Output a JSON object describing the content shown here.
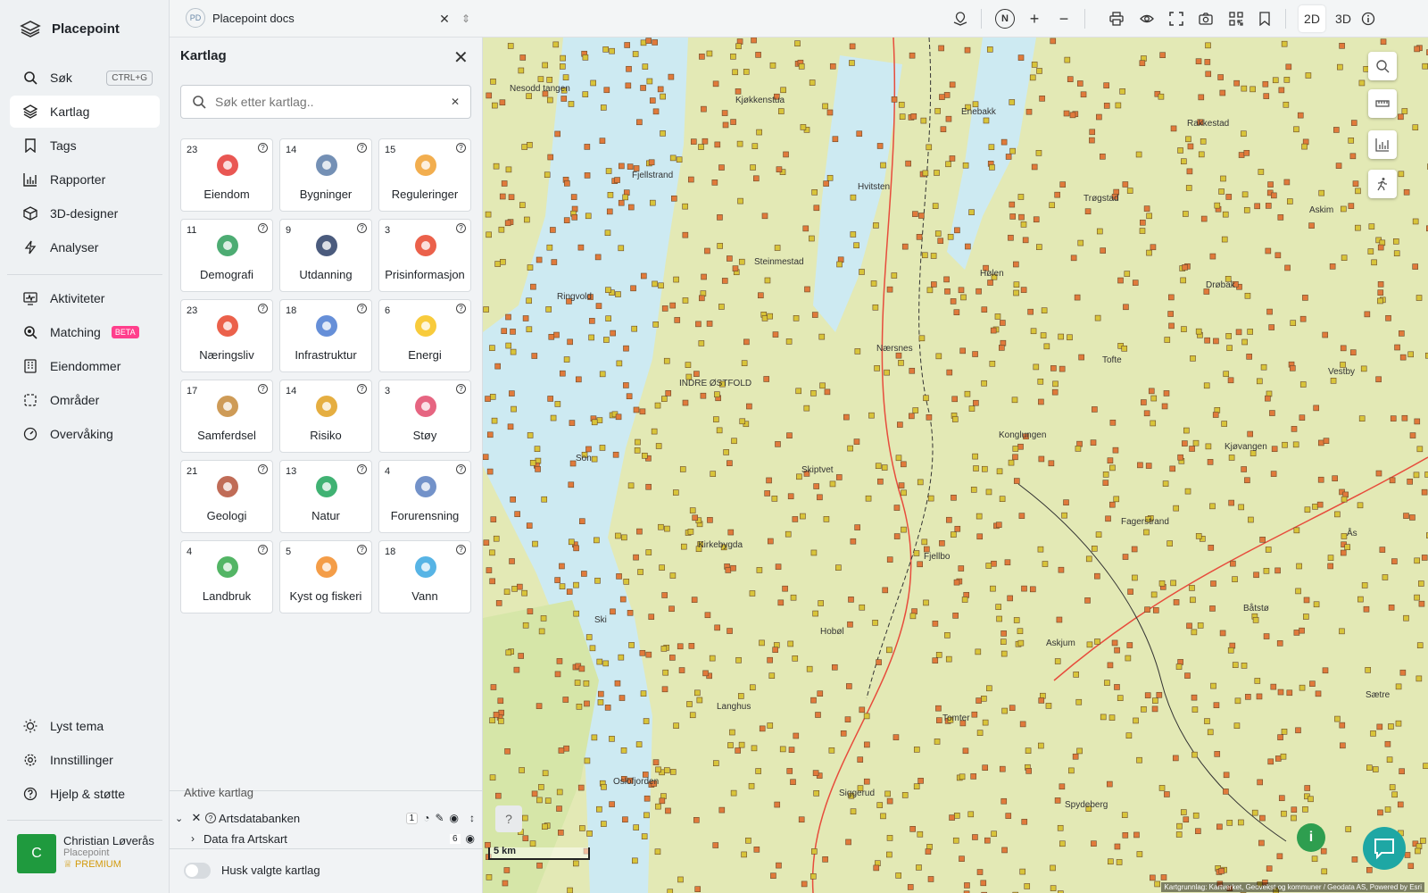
{
  "app": {
    "name": "Placepoint"
  },
  "sidebar": {
    "items": [
      {
        "label": "Søk",
        "shortcut": "CTRL+G",
        "icon": "search-icon"
      },
      {
        "label": "Kartlag",
        "icon": "layers-icon"
      },
      {
        "label": "Tags",
        "icon": "bookmark-icon"
      },
      {
        "label": "Rapporter",
        "icon": "bar-chart-icon"
      },
      {
        "label": "3D-designer",
        "icon": "cube-icon"
      },
      {
        "label": "Analyser",
        "icon": "lightning-icon"
      },
      {
        "label": "Aktiviteter",
        "icon": "activity-icon"
      },
      {
        "label": "Matching",
        "badge": "BETA",
        "icon": "search-zoom-icon"
      },
      {
        "label": "Eiendommer",
        "icon": "building-icon"
      },
      {
        "label": "Områder",
        "icon": "dashed-square-icon"
      },
      {
        "label": "Overvåking",
        "icon": "gauge-icon"
      }
    ],
    "bottom": [
      {
        "label": "Lyst tema",
        "icon": "sun-icon"
      },
      {
        "label": "Innstillinger",
        "icon": "gear-icon"
      },
      {
        "label": "Hjelp & støtte",
        "icon": "help-icon"
      }
    ],
    "user": {
      "initial": "C",
      "name": "Christian Løverås",
      "org": "Placepoint",
      "plan": "PREMIUM"
    }
  },
  "topbar": {
    "doc_badge": "PD",
    "doc_title": "Placepoint docs",
    "compass": "N",
    "mode_2d": "2D",
    "mode_3d": "3D"
  },
  "panel": {
    "title": "Kartlag",
    "search_placeholder": "Søk etter kartlag..",
    "categories": [
      {
        "count": "23",
        "label": "Eiendom",
        "icon": "map-pin-icon",
        "color": "#e53935"
      },
      {
        "count": "14",
        "label": "Bygninger",
        "icon": "office-building-icon",
        "color": "#5c7da8"
      },
      {
        "count": "15",
        "label": "Reguleringer",
        "icon": "signpost-icon",
        "color": "#f0a030"
      },
      {
        "count": "11",
        "label": "Demografi",
        "icon": "population-icon",
        "color": "#2e9e5b"
      },
      {
        "count": "9",
        "label": "Utdanning",
        "icon": "graduation-cap-icon",
        "color": "#2c3e66"
      },
      {
        "count": "3",
        "label": "Prisinformasjon",
        "icon": "shopping-bag-icon",
        "color": "#e8452c"
      },
      {
        "count": "23",
        "label": "Næringsliv",
        "icon": "shopping-bags-icon",
        "color": "#e8452c"
      },
      {
        "count": "18",
        "label": "Infrastruktur",
        "icon": "infrastructure-icon",
        "color": "#4b7bd1"
      },
      {
        "count": "6",
        "label": "Energi",
        "icon": "lightning-bolt-icon",
        "color": "#f7c21a"
      },
      {
        "count": "17",
        "label": "Samferdsel",
        "icon": "train-icon",
        "color": "#c58a3a"
      },
      {
        "count": "14",
        "label": "Risiko",
        "icon": "warning-icon",
        "color": "#e0a020"
      },
      {
        "count": "3",
        "label": "Støy",
        "icon": "noise-gauge-icon",
        "color": "#e24a6b"
      },
      {
        "count": "21",
        "label": "Geologi",
        "icon": "terrain-icon",
        "color": "#b5523a"
      },
      {
        "count": "13",
        "label": "Natur",
        "icon": "leaf-icon",
        "color": "#1ea45a"
      },
      {
        "count": "4",
        "label": "Forurensning",
        "icon": "factory-icon",
        "color": "#5a7fbf"
      },
      {
        "count": "4",
        "label": "Landbruk",
        "icon": "sprout-icon",
        "color": "#35a84a"
      },
      {
        "count": "5",
        "label": "Kyst og fiskeri",
        "icon": "fish-icon",
        "color": "#f28c28"
      },
      {
        "count": "18",
        "label": "Vann",
        "icon": "water-drop-icon",
        "color": "#3aa7e0"
      }
    ],
    "active_title": "Aktive kartlag",
    "active_layers": [
      {
        "label": "Artsdatabanken",
        "count": "1"
      },
      {
        "label": "Data fra Artskart",
        "count": "6"
      }
    ],
    "remember_label": "Husk valgte kartlag"
  },
  "map": {
    "scale": "5 km",
    "attribution": "Kartgrunnlag: Kartverket, Geovekst og kommuner / Geodata AS, Powered by Esri",
    "place_labels": [
      "Nesodd tangen",
      "Fjellstrand",
      "Steinmestad",
      "Nærsnes",
      "Konglungen",
      "Fagerstrand",
      "Båtstø",
      "Sætre",
      "Oslofjorden",
      "Kjøkkenstua",
      "Hvitsten",
      "Hølen",
      "Tofte",
      "Kjøvangen",
      "Ås",
      "Ski",
      "Langhus",
      "Siggerud",
      "Enebakk",
      "Trøgstad",
      "Drøbak",
      "Vestby",
      "Son",
      "Kirkebygda",
      "Hobøl",
      "Tomter",
      "Spydeberg",
      "Rakkestad",
      "Askim",
      "Ringvold",
      "INDRE ØSTFOLD",
      "Skiptvet",
      "Fjellbo",
      "Askjum"
    ]
  }
}
